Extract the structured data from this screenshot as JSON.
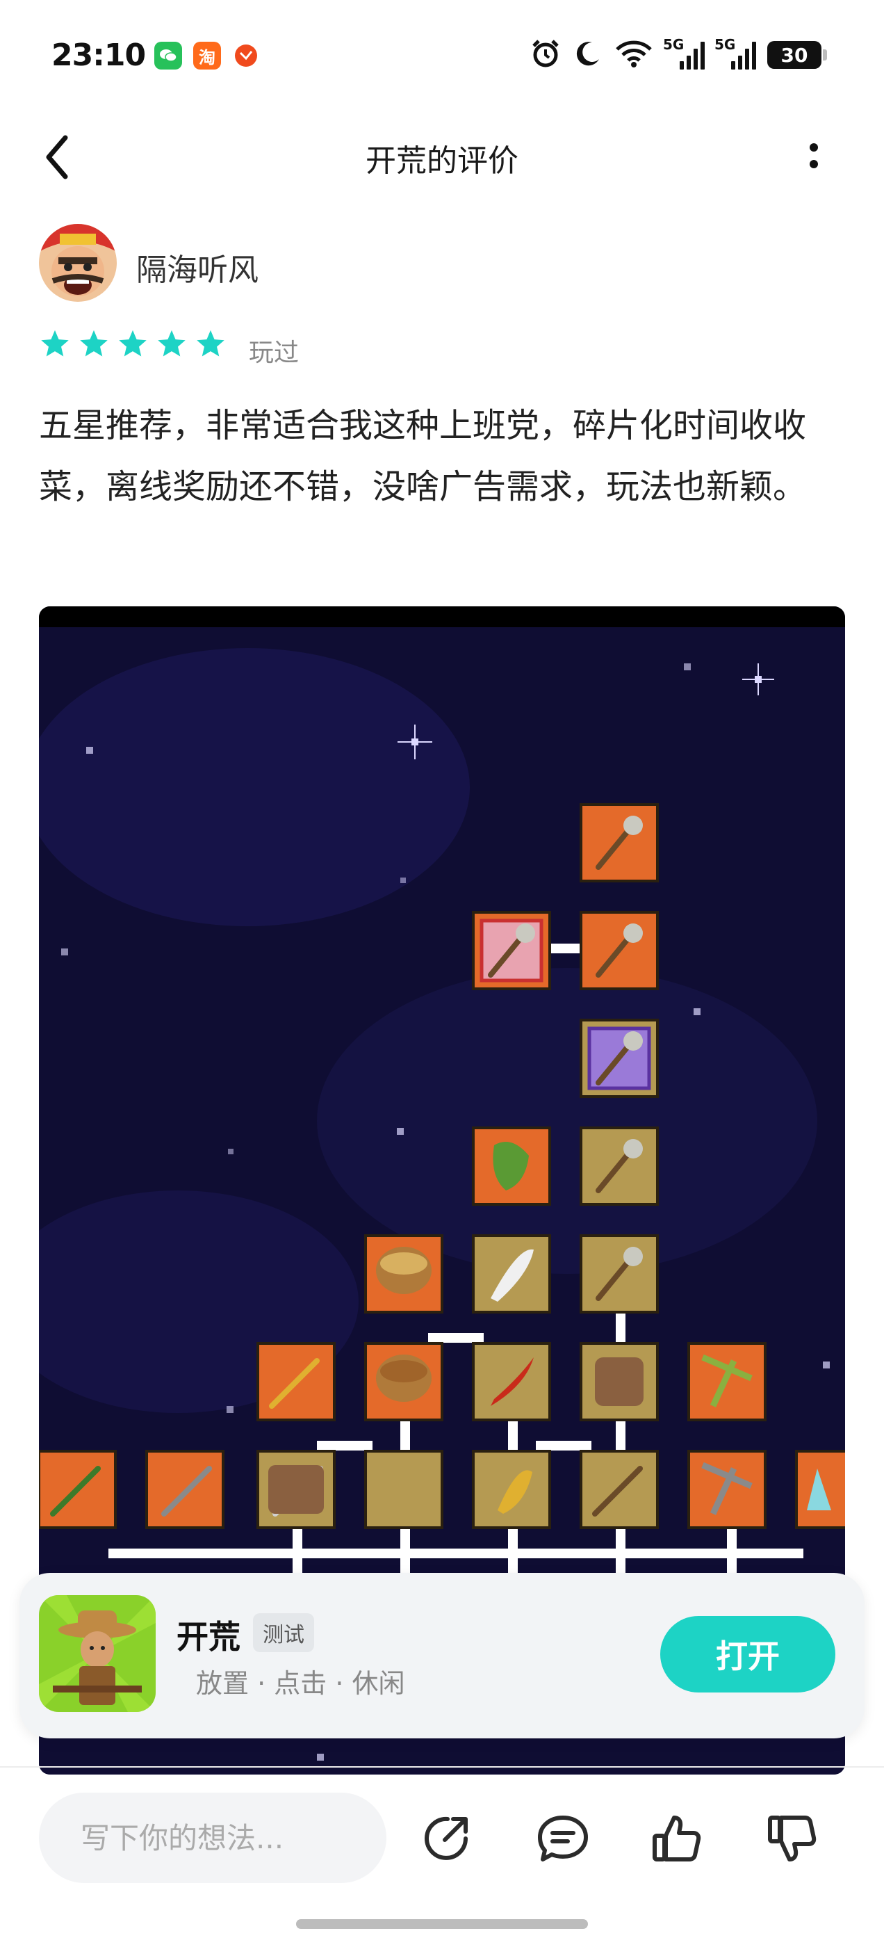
{
  "status_bar": {
    "time": "23:10",
    "apps": [
      {
        "icon": "wechat-icon",
        "glyph": "✉",
        "color": "#27c15a"
      },
      {
        "icon": "taobao-icon",
        "glyph": "淘",
        "color": "#ff6a1a"
      },
      {
        "icon": "app-red-icon",
        "glyph": "✦",
        "color": "#f04a1d"
      }
    ],
    "network_1": "5G",
    "network_2": "5G",
    "battery": "30"
  },
  "header": {
    "title": "开荒的评价",
    "back_icon": "back-arrow-icon",
    "more_icon": "more-vertical-icon"
  },
  "review": {
    "author": "隔海听风",
    "rating": 5,
    "played_label": "玩过",
    "star_color": "#1dd3c5",
    "text": "五星推荐，非常适合我这种上班党，碎片化时间收收菜，离线奖励还不错，没啥广告需求，玩法也新颖。"
  },
  "app_card": {
    "name": "开荒",
    "badge": "测试",
    "tags": "放置 · 点击 · 休闲",
    "open_label": "打开",
    "button_color": "#1dd3c5"
  },
  "bottom_bar": {
    "input_placeholder": "写下你的想法...",
    "icons": [
      "share-icon",
      "comment-icon",
      "thumbs-up-icon",
      "thumbs-down-icon"
    ]
  }
}
